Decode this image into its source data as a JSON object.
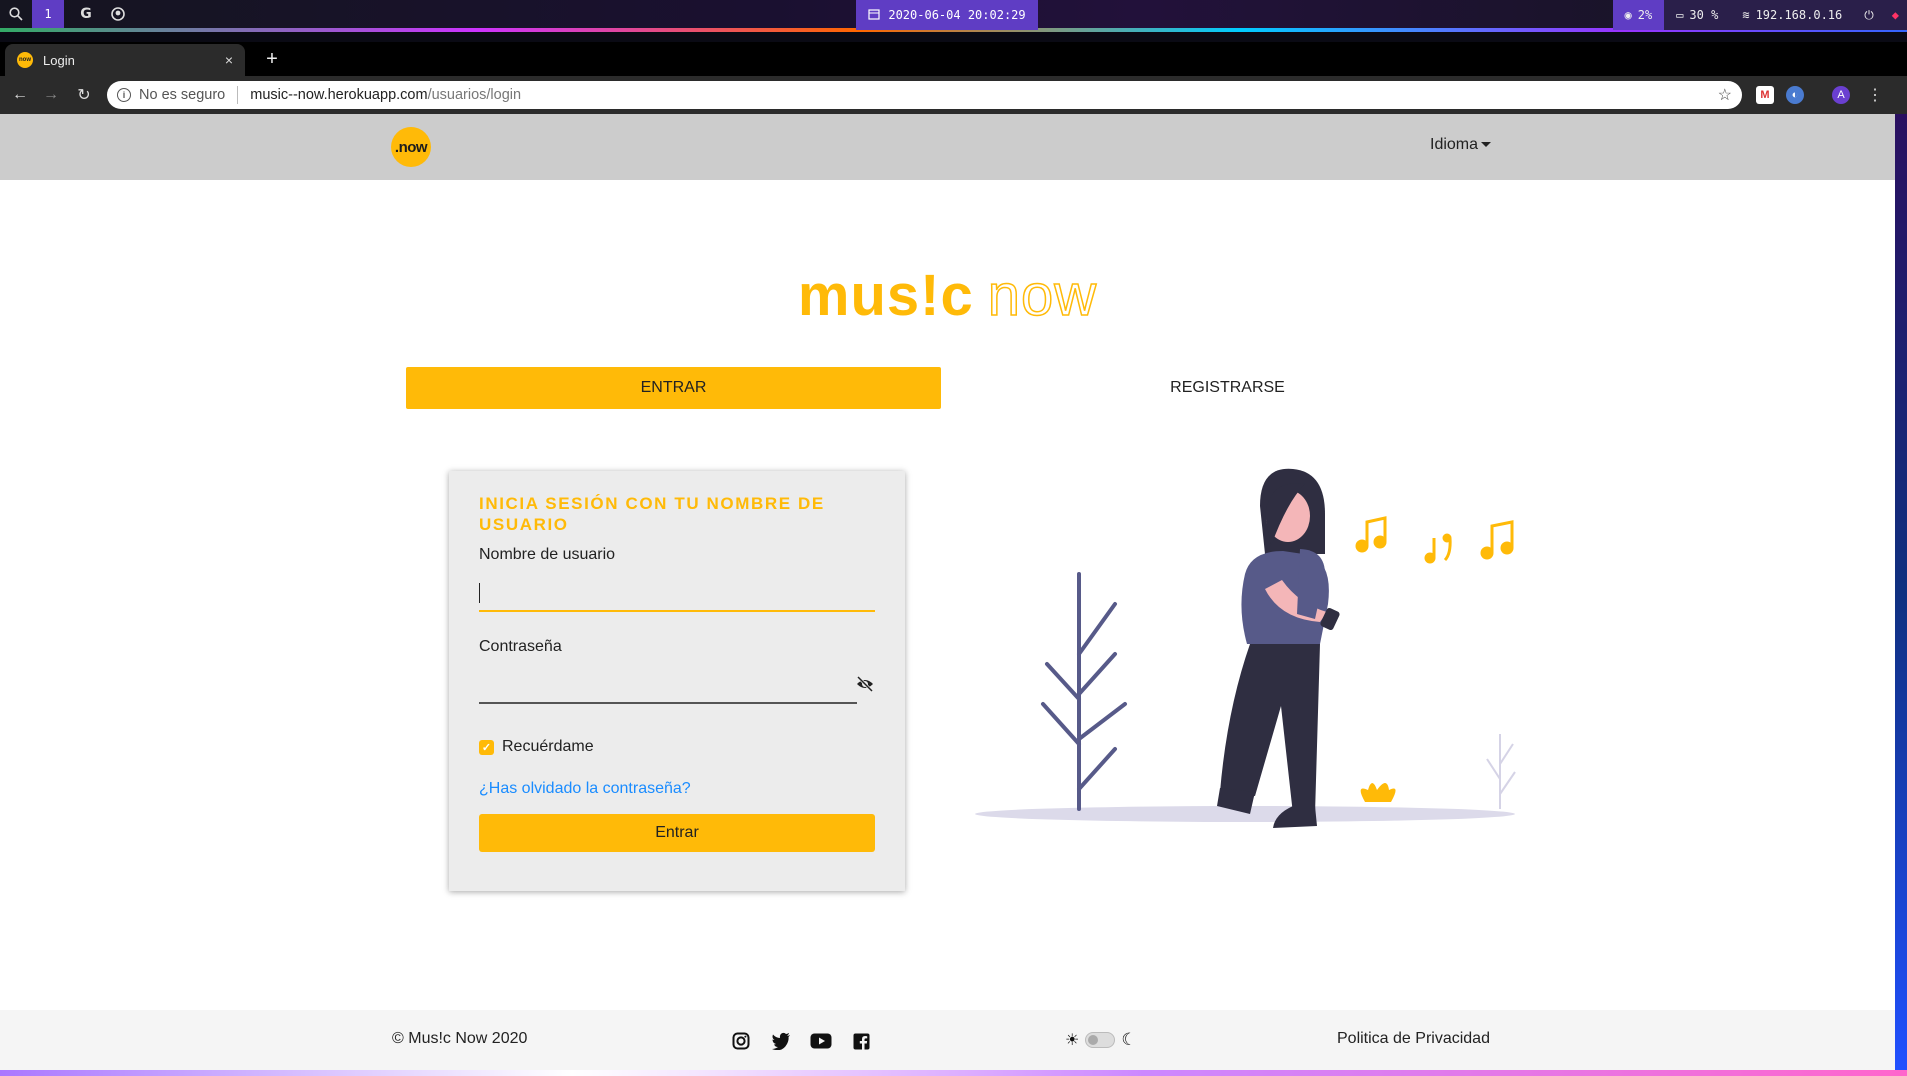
{
  "os": {
    "workspace": "1",
    "datetime": "2020-06-04 20:02:29",
    "cpu": "2%",
    "disk": "30 %",
    "ip": "192.168.0.16"
  },
  "browser": {
    "tab_title": "Login",
    "tab_close": "×",
    "new_tab": "+",
    "security_label": "No es seguro",
    "url_host": "music--now.herokuapp.com",
    "url_path": "/usuarios/login",
    "profile_initial": "A"
  },
  "navbar": {
    "logo_text": ".now",
    "language_label": "Idioma"
  },
  "hero": {
    "word1": "mus!c",
    "word2": "now"
  },
  "tabs": {
    "login": "ENTRAR",
    "register": "REGISTRARSE"
  },
  "form": {
    "title": "INICIA SESIÓN CON TU NOMBRE DE USUARIO",
    "username_label": "Nombre de usuario",
    "username_value": "",
    "password_label": "Contraseña",
    "password_value": "",
    "remember_label": "Recuérdame",
    "remember_checked": true,
    "forgot_link": "¿Has olvidado la contraseña?",
    "submit_label": "Entrar"
  },
  "footer": {
    "copyright": "© Mus!c Now 2020",
    "privacy": "Politica de Privacidad"
  },
  "colors": {
    "brand": "#ffba08",
    "navbar": "#cccccc",
    "link": "#1a8cff",
    "illustration_dark": "#2f2e41",
    "illustration_purple": "#575a89"
  }
}
